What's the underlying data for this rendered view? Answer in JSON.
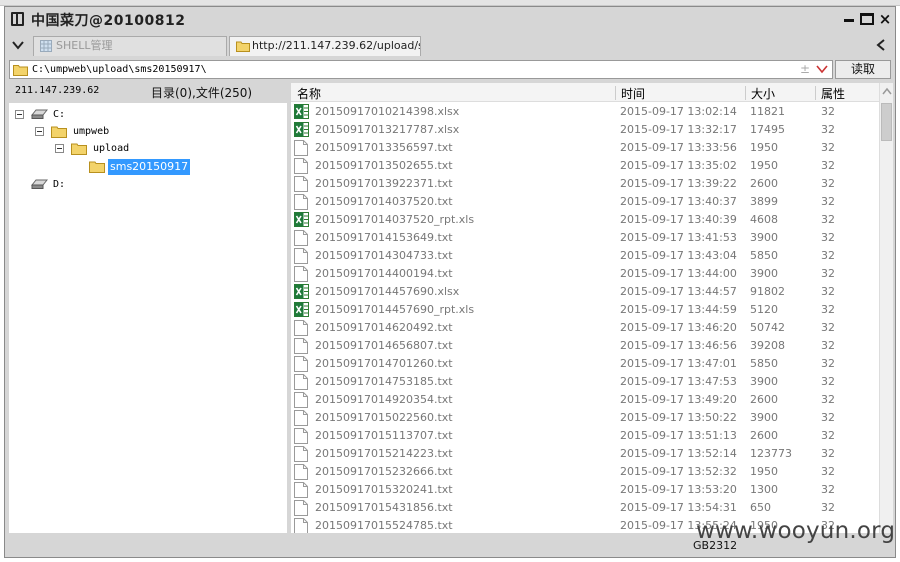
{
  "window": {
    "title": "中国菜刀@20100812",
    "controls": {
      "minimize": "minimize",
      "maximize": "maximize",
      "close": "×"
    }
  },
  "tabs": [
    {
      "label": "SHELL管理",
      "icon": "grid-icon",
      "active": false
    },
    {
      "label": "http://211.147.239.62/upload/s...",
      "icon": "folder-icon",
      "active": true
    }
  ],
  "address": {
    "path": "C:\\umpweb\\upload\\sms20150917\\",
    "plus_minus": "±",
    "read_label": "读取"
  },
  "info": {
    "ip": "211.147.239.62",
    "count": "目录(0),文件(250)"
  },
  "tree": [
    {
      "label": "C:",
      "type": "drive",
      "expanded": true
    },
    {
      "label": "umpweb",
      "type": "folder",
      "expanded": true
    },
    {
      "label": "upload",
      "type": "folder",
      "expanded": true
    },
    {
      "label": "sms20150917",
      "type": "folder",
      "selected": true
    },
    {
      "label": "D:",
      "type": "drive"
    }
  ],
  "columns": {
    "name": "名称",
    "time": "时间",
    "size": "大小",
    "attr": "属性"
  },
  "files": [
    {
      "name": "20150917010214398.xlsx",
      "time": "2015-09-17 13:02:14",
      "size": "11821",
      "attr": "32",
      "type": "excel"
    },
    {
      "name": "20150917013217787.xlsx",
      "time": "2015-09-17 13:32:17",
      "size": "17495",
      "attr": "32",
      "type": "excel"
    },
    {
      "name": "20150917013356597.txt",
      "time": "2015-09-17 13:33:56",
      "size": "1950",
      "attr": "32",
      "type": "text"
    },
    {
      "name": "20150917013502655.txt",
      "time": "2015-09-17 13:35:02",
      "size": "1950",
      "attr": "32",
      "type": "text"
    },
    {
      "name": "20150917013922371.txt",
      "time": "2015-09-17 13:39:22",
      "size": "2600",
      "attr": "32",
      "type": "text"
    },
    {
      "name": "20150917014037520.txt",
      "time": "2015-09-17 13:40:37",
      "size": "3899",
      "attr": "32",
      "type": "text"
    },
    {
      "name": "20150917014037520_rpt.xls",
      "time": "2015-09-17 13:40:39",
      "size": "4608",
      "attr": "32",
      "type": "excel"
    },
    {
      "name": "20150917014153649.txt",
      "time": "2015-09-17 13:41:53",
      "size": "3900",
      "attr": "32",
      "type": "text"
    },
    {
      "name": "20150917014304733.txt",
      "time": "2015-09-17 13:43:04",
      "size": "5850",
      "attr": "32",
      "type": "text"
    },
    {
      "name": "20150917014400194.txt",
      "time": "2015-09-17 13:44:00",
      "size": "3900",
      "attr": "32",
      "type": "text"
    },
    {
      "name": "20150917014457690.xlsx",
      "time": "2015-09-17 13:44:57",
      "size": "91802",
      "attr": "32",
      "type": "excel"
    },
    {
      "name": "20150917014457690_rpt.xls",
      "time": "2015-09-17 13:44:59",
      "size": "5120",
      "attr": "32",
      "type": "excel"
    },
    {
      "name": "20150917014620492.txt",
      "time": "2015-09-17 13:46:20",
      "size": "50742",
      "attr": "32",
      "type": "text"
    },
    {
      "name": "20150917014656807.txt",
      "time": "2015-09-17 13:46:56",
      "size": "39208",
      "attr": "32",
      "type": "text"
    },
    {
      "name": "20150917014701260.txt",
      "time": "2015-09-17 13:47:01",
      "size": "5850",
      "attr": "32",
      "type": "text"
    },
    {
      "name": "20150917014753185.txt",
      "time": "2015-09-17 13:47:53",
      "size": "3900",
      "attr": "32",
      "type": "text"
    },
    {
      "name": "20150917014920354.txt",
      "time": "2015-09-17 13:49:20",
      "size": "2600",
      "attr": "32",
      "type": "text"
    },
    {
      "name": "20150917015022560.txt",
      "time": "2015-09-17 13:50:22",
      "size": "3900",
      "attr": "32",
      "type": "text"
    },
    {
      "name": "20150917015113707.txt",
      "time": "2015-09-17 13:51:13",
      "size": "2600",
      "attr": "32",
      "type": "text"
    },
    {
      "name": "20150917015214223.txt",
      "time": "2015-09-17 13:52:14",
      "size": "123773",
      "attr": "32",
      "type": "text"
    },
    {
      "name": "20150917015232666.txt",
      "time": "2015-09-17 13:52:32",
      "size": "1950",
      "attr": "32",
      "type": "text"
    },
    {
      "name": "20150917015320241.txt",
      "time": "2015-09-17 13:53:20",
      "size": "1300",
      "attr": "32",
      "type": "text"
    },
    {
      "name": "20150917015431856.txt",
      "time": "2015-09-17 13:54:31",
      "size": "650",
      "attr": "32",
      "type": "text"
    },
    {
      "name": "20150917015524785.txt",
      "time": "2015-09-17 13:55:24",
      "size": "1950",
      "attr": "32",
      "type": "text"
    }
  ],
  "status": {
    "encoding": "GB2312"
  },
  "watermark": "www.wooyun.org",
  "colors": {
    "selection": "#3399ff",
    "excel": "#1f7a3a",
    "folder": "#e8b830"
  }
}
